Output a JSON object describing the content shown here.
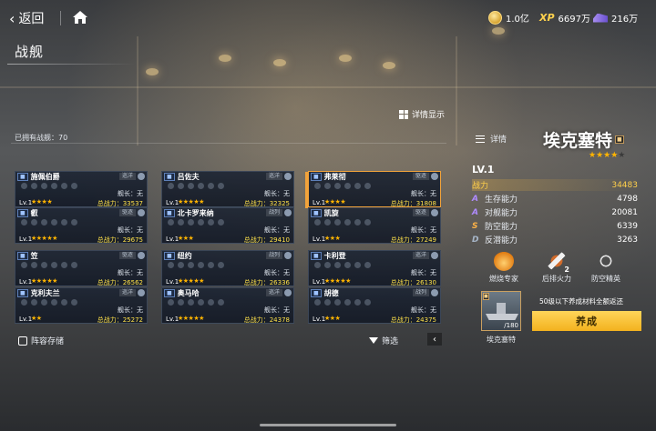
{
  "topbar": {
    "back_label": "返回",
    "resources": [
      {
        "icon": "coin-icon",
        "value": "1.0亿"
      },
      {
        "icon": "xp-icon",
        "label": "XP",
        "value": "6697万"
      },
      {
        "icon": "ship-resource-icon",
        "value": "216万"
      }
    ]
  },
  "page": {
    "title": "战舰",
    "owned_label": "已拥有战舰：70",
    "detail_toggle": "详情显示",
    "formation_label": "阵容存储",
    "filter_label": "筛选"
  },
  "ships": [
    {
      "name": "施佩伯爵",
      "type": "巡洋",
      "captain": "舰长：无",
      "lv": "Lv.1",
      "stars": "★★★★",
      "power": "总战力：33537",
      "selected": false
    },
    {
      "name": "吕佐夫",
      "type": "巡洋",
      "captain": "舰长：无",
      "lv": "Lv.1",
      "stars": "★★★★★",
      "power": "总战力：32325",
      "selected": false
    },
    {
      "name": "弗莱彻",
      "type": "驱逐",
      "captain": "舰长：无",
      "lv": "Lv.1",
      "stars": "★★★★",
      "power": "总战力：31808",
      "selected": true
    },
    {
      "name": "叡",
      "type": "驱逐",
      "captain": "舰长：无",
      "lv": "Lv.1",
      "stars": "★★★★★",
      "power": "总战力：29675",
      "selected": false
    },
    {
      "name": "北卡罗来纳",
      "type": "战列",
      "captain": "舰长：无",
      "lv": "Lv.1",
      "stars": "★★★",
      "power": "总战力：29410",
      "selected": false
    },
    {
      "name": "凯旋",
      "type": "驱逐",
      "captain": "舰长：无",
      "lv": "Lv.1",
      "stars": "★★★",
      "power": "总战力：27249",
      "selected": false
    },
    {
      "name": "笠",
      "type": "驱逐",
      "captain": "舰长：无",
      "lv": "Lv.1",
      "stars": "★★★★★",
      "power": "总战力：26562",
      "selected": false
    },
    {
      "name": "纽约",
      "type": "战列",
      "captain": "舰长：无",
      "lv": "Lv.1",
      "stars": "★★★★★",
      "power": "总战力：26336",
      "selected": false
    },
    {
      "name": "卡利登",
      "type": "巡洋",
      "captain": "舰长：无",
      "lv": "Lv.1",
      "stars": "★★★★★",
      "power": "总战力：26130",
      "selected": false
    },
    {
      "name": "克利夫兰",
      "type": "巡洋",
      "captain": "舰长：无",
      "lv": "Lv.1",
      "stars": "★★",
      "power": "总战力：25272",
      "selected": false
    },
    {
      "name": "奥马哈",
      "type": "巡洋",
      "captain": "舰长：无",
      "lv": "Lv.1",
      "stars": "★★★★★",
      "power": "总战力：24378",
      "selected": false
    },
    {
      "name": "胡德",
      "type": "战列",
      "captain": "舰长：无",
      "lv": "Lv.1",
      "stars": "★★★",
      "power": "总战力：24375",
      "selected": false
    }
  ],
  "detail": {
    "detail_btn": "详情",
    "ship_name": "埃克塞特",
    "stars": "★★★★",
    "empty_star": "★",
    "level": "LV.1",
    "power_label": "战力",
    "power_value": "34483",
    "stats": [
      {
        "grade": "A",
        "label": "生存能力",
        "value": "4798"
      },
      {
        "grade": "A",
        "label": "对舰能力",
        "value": "20081"
      },
      {
        "grade": "S",
        "label": "防空能力",
        "value": "6339"
      },
      {
        "grade": "D",
        "label": "反潜能力",
        "value": "3263"
      }
    ],
    "skills": [
      {
        "icon": "fire-icon",
        "label": "燃烧专家"
      },
      {
        "icon": "missile-icon",
        "label": "后排火力",
        "level": "2"
      },
      {
        "icon": "anti-air-icon",
        "label": "防空精英"
      }
    ],
    "thumb_count": "/180",
    "thumb_label": "埃克塞特",
    "return_note": "50级以下养成材料全额返还",
    "develop_btn": "养成"
  }
}
